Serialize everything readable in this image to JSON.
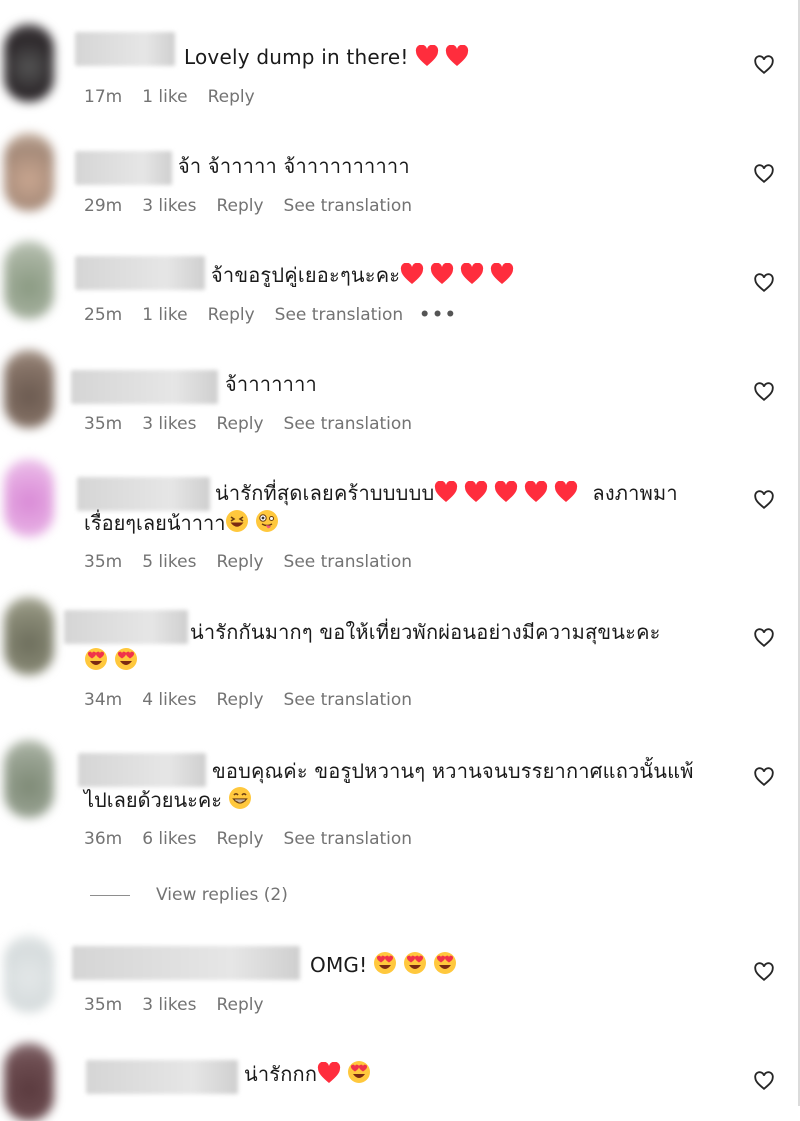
{
  "colors": {
    "meta": "#737373",
    "text": "#1a1a1a",
    "heart": "#ff2d3d"
  },
  "comments": [
    {
      "text": "Lovely dump in there!",
      "time": "17m",
      "likes": "1 like",
      "reply": "Reply",
      "translation": "",
      "emojis": [
        "red-heart",
        "red-heart"
      ]
    },
    {
      "text": "จ้า จ้าาาาา จ้าาาาาาาาาา",
      "time": "29m",
      "likes": "3 likes",
      "reply": "Reply",
      "translation": "See translation",
      "emojis": []
    },
    {
      "text": "จ้าขอรูปคู่เยอะๆนะคะ",
      "time": "25m",
      "likes": "1 like",
      "reply": "Reply",
      "translation": "See translation",
      "more": "•••",
      "emojis": [
        "red-heart",
        "red-heart",
        "red-heart",
        "red-heart"
      ]
    },
    {
      "text": "จ้าาาาาาา",
      "time": "35m",
      "likes": "3 likes",
      "reply": "Reply",
      "translation": "See translation",
      "emojis": []
    },
    {
      "text": "น่ารักที่สุดเลยคร้าบบบบบ",
      "text_line2_prefix": "ลงภาพมา",
      "text_line2": "เรื่อยๆเลยน้าาาา",
      "time": "35m",
      "likes": "5 likes",
      "reply": "Reply",
      "translation": "See translation",
      "emojis": [
        "red-heart",
        "red-heart",
        "red-heart",
        "red-heart",
        "red-heart"
      ],
      "emojis_line2": [
        "grinning-squint-face",
        "zany-face"
      ]
    },
    {
      "text": "น่ารักกันมากๆ ขอให้เที่ยวพักผ่อนอย่างมีความสุขนะคะ",
      "time": "34m",
      "likes": "4 likes",
      "reply": "Reply",
      "translation": "See translation",
      "emojis_line2": [
        "heart-eyes-face",
        "heart-eyes-face"
      ]
    },
    {
      "text": "ขอบคุณค่ะ ขอรูปหวานๆ หวานจนบรรยากาศแถวนั้นแพ้",
      "text_line2": "ไปเลยด้วยนะคะ",
      "time": "36m",
      "likes": "6 likes",
      "reply": "Reply",
      "translation": "See translation",
      "emojis_line2": [
        "beaming-face"
      ]
    },
    {
      "text": "OMG!",
      "time": "35m",
      "likes": "3 likes",
      "reply": "Reply",
      "translation": "",
      "emojis": [
        "heart-eyes-face",
        "heart-eyes-face",
        "heart-eyes-face"
      ]
    },
    {
      "text": "น่ารักกก",
      "time": "",
      "likes": "",
      "reply": "",
      "translation": "",
      "emojis": [
        "red-heart",
        "heart-eyes-face"
      ]
    }
  ],
  "view_replies": "View replies (2)"
}
